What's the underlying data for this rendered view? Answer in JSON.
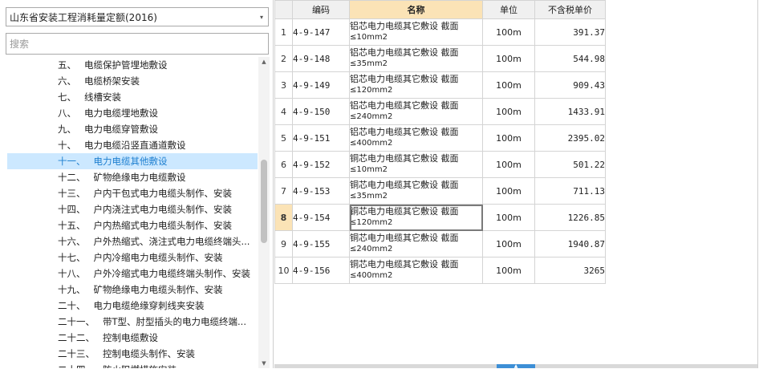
{
  "left_panel": {
    "dropdown_value": "山东省安装工程消耗量定额(2016)",
    "search_placeholder": "搜索",
    "tree": [
      {
        "num": "五、",
        "label": "电缆保护管埋地敷设"
      },
      {
        "num": "六、",
        "label": "电缆桥架安装"
      },
      {
        "num": "七、",
        "label": "线槽安装"
      },
      {
        "num": "八、",
        "label": "电力电缆埋地敷设"
      },
      {
        "num": "九、",
        "label": "电力电缆穿管敷设"
      },
      {
        "num": "十、",
        "label": "电力电缆沿竖直通道敷设"
      },
      {
        "num": "十一、",
        "label": "电力电缆其他敷设"
      },
      {
        "num": "十二、",
        "label": "矿物绝缘电力电缆敷设"
      },
      {
        "num": "十三、",
        "label": "户内干包式电力电缆头制作、安装"
      },
      {
        "num": "十四、",
        "label": "户内浇注式电力电缆头制作、安装"
      },
      {
        "num": "十五、",
        "label": "户内热缩式电力电缆头制作、安装"
      },
      {
        "num": "十六、",
        "label": "户外热缩式、浇注式电力电缆终端头..."
      },
      {
        "num": "十七、",
        "label": "户内冷缩电力电缆头制作、安装"
      },
      {
        "num": "十八、",
        "label": "户外冷缩式电力电缆终端头制作、安装"
      },
      {
        "num": "十九、",
        "label": "矿物绝缘电力电缆头制作、安装"
      },
      {
        "num": "二十、",
        "label": "电力电缆绝缘穿刺线夹安装"
      },
      {
        "num": "二十一、",
        "label": "带T型、肘型插头的电力电缆终端..."
      },
      {
        "num": "二十二、",
        "label": "控制电缆敷设"
      },
      {
        "num": "二十三、",
        "label": "控制电缆头制作、安装"
      },
      {
        "num": "二十四、",
        "label": "防火阻燃措施安装"
      }
    ],
    "selected_index": 6
  },
  "grid": {
    "headers": {
      "row": "",
      "code": "编码",
      "name": "名称",
      "unit": "单位",
      "price": "不含税单价"
    },
    "selected_row": 8,
    "rows": [
      {
        "n": "1",
        "code": "4-9-147",
        "name": "铝芯电力电缆其它敷设 截面",
        "spec": "≤10mm2",
        "unit": "100m",
        "price": "391.37"
      },
      {
        "n": "2",
        "code": "4-9-148",
        "name": "铝芯电力电缆其它敷设 截面",
        "spec": "≤35mm2",
        "unit": "100m",
        "price": "544.98"
      },
      {
        "n": "3",
        "code": "4-9-149",
        "name": "铝芯电力电缆其它敷设 截面",
        "spec": "≤120mm2",
        "unit": "100m",
        "price": "909.43"
      },
      {
        "n": "4",
        "code": "4-9-150",
        "name": "铝芯电力电缆其它敷设 截面",
        "spec": "≤240mm2",
        "unit": "100m",
        "price": "1433.91"
      },
      {
        "n": "5",
        "code": "4-9-151",
        "name": "铝芯电力电缆其它敷设 截面",
        "spec": "≤400mm2",
        "unit": "100m",
        "price": "2395.02"
      },
      {
        "n": "6",
        "code": "4-9-152",
        "name": "铜芯电力电缆其它敷设 截面",
        "spec": "≤10mm2",
        "unit": "100m",
        "price": "501.22"
      },
      {
        "n": "7",
        "code": "4-9-153",
        "name": "铜芯电力电缆其它敷设 截面",
        "spec": "≤35mm2",
        "unit": "100m",
        "price": "711.13"
      },
      {
        "n": "8",
        "code": "4-9-154",
        "name": "铜芯电力电缆其它敷设 截面",
        "spec": "≤120mm2",
        "unit": "100m",
        "price": "1226.85"
      },
      {
        "n": "9",
        "code": "4-9-155",
        "name": "铜芯电力电缆其它敷设 截面",
        "spec": "≤240mm2",
        "unit": "100m",
        "price": "1940.87"
      },
      {
        "n": "10",
        "code": "4-9-156",
        "name": "铜芯电力电缆其它敷设 截面",
        "spec": "≤400mm2",
        "unit": "100m",
        "price": "3265"
      }
    ]
  },
  "icons": {
    "dropdown_caret": "▾",
    "scroll_up": "▲",
    "scroll_down": "▼",
    "splitter_grip": "▲"
  },
  "colors": {
    "selected_tree_bg": "#cce8ff",
    "selected_tree_text": "#1d7fd0",
    "header_highlight": "#fbe3b6",
    "splitter_accent": "#3d8fd6"
  }
}
